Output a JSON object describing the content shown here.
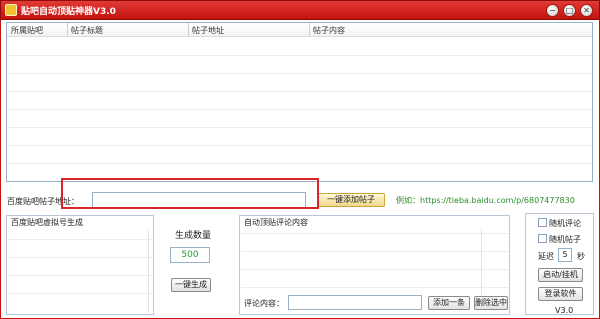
{
  "window": {
    "title": "贴吧自动顶贴神器V3.0",
    "controls": {
      "minimize": "−",
      "maximize": "□",
      "close": "✕"
    }
  },
  "posts_table": {
    "columns": [
      "所属贴吧",
      "帖子标题",
      "帖子地址",
      "帖子内容"
    ],
    "rows": []
  },
  "url_row": {
    "label": "百度贴吧帖子地址：",
    "input_value": "",
    "add_button": "一键添加帖子",
    "example": "例如：https://tieba.baidu.com/p/6807477830"
  },
  "virtual_accounts": {
    "title": "百度贴吧虚拟号生成"
  },
  "generate": {
    "count_label": "生成数量",
    "count_value": "500",
    "button": "一键生成"
  },
  "auto_comments": {
    "title": "自动顶贴评论内容",
    "comment_label": "评论内容：",
    "comment_value": "",
    "add_button": "添加一条",
    "delete_button": "删除选中"
  },
  "options": {
    "random_comment": "随机评论",
    "random_post": "随机帖子",
    "delay_label": "延迟",
    "delay_value": "5",
    "delay_unit": "秒",
    "start_button": "启动/挂机",
    "login_button": "登录软件",
    "version": "V3.0"
  }
}
